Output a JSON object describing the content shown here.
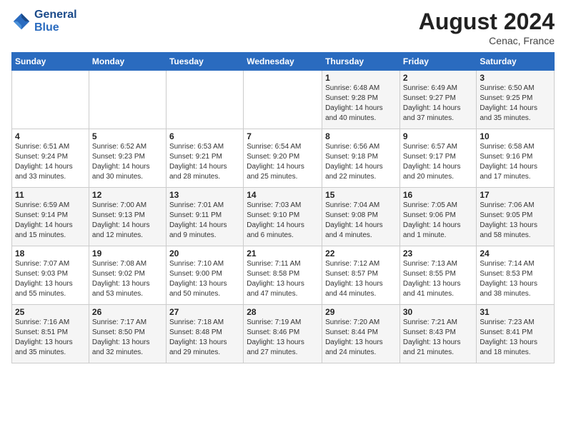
{
  "header": {
    "logo_line1": "General",
    "logo_line2": "Blue",
    "month_title": "August 2024",
    "location": "Cenac, France"
  },
  "weekdays": [
    "Sunday",
    "Monday",
    "Tuesday",
    "Wednesday",
    "Thursday",
    "Friday",
    "Saturday"
  ],
  "weeks": [
    [
      {
        "day": "",
        "info": ""
      },
      {
        "day": "",
        "info": ""
      },
      {
        "day": "",
        "info": ""
      },
      {
        "day": "",
        "info": ""
      },
      {
        "day": "1",
        "info": "Sunrise: 6:48 AM\nSunset: 9:28 PM\nDaylight: 14 hours\nand 40 minutes."
      },
      {
        "day": "2",
        "info": "Sunrise: 6:49 AM\nSunset: 9:27 PM\nDaylight: 14 hours\nand 37 minutes."
      },
      {
        "day": "3",
        "info": "Sunrise: 6:50 AM\nSunset: 9:25 PM\nDaylight: 14 hours\nand 35 minutes."
      }
    ],
    [
      {
        "day": "4",
        "info": "Sunrise: 6:51 AM\nSunset: 9:24 PM\nDaylight: 14 hours\nand 33 minutes."
      },
      {
        "day": "5",
        "info": "Sunrise: 6:52 AM\nSunset: 9:23 PM\nDaylight: 14 hours\nand 30 minutes."
      },
      {
        "day": "6",
        "info": "Sunrise: 6:53 AM\nSunset: 9:21 PM\nDaylight: 14 hours\nand 28 minutes."
      },
      {
        "day": "7",
        "info": "Sunrise: 6:54 AM\nSunset: 9:20 PM\nDaylight: 14 hours\nand 25 minutes."
      },
      {
        "day": "8",
        "info": "Sunrise: 6:56 AM\nSunset: 9:18 PM\nDaylight: 14 hours\nand 22 minutes."
      },
      {
        "day": "9",
        "info": "Sunrise: 6:57 AM\nSunset: 9:17 PM\nDaylight: 14 hours\nand 20 minutes."
      },
      {
        "day": "10",
        "info": "Sunrise: 6:58 AM\nSunset: 9:16 PM\nDaylight: 14 hours\nand 17 minutes."
      }
    ],
    [
      {
        "day": "11",
        "info": "Sunrise: 6:59 AM\nSunset: 9:14 PM\nDaylight: 14 hours\nand 15 minutes."
      },
      {
        "day": "12",
        "info": "Sunrise: 7:00 AM\nSunset: 9:13 PM\nDaylight: 14 hours\nand 12 minutes."
      },
      {
        "day": "13",
        "info": "Sunrise: 7:01 AM\nSunset: 9:11 PM\nDaylight: 14 hours\nand 9 minutes."
      },
      {
        "day": "14",
        "info": "Sunrise: 7:03 AM\nSunset: 9:10 PM\nDaylight: 14 hours\nand 6 minutes."
      },
      {
        "day": "15",
        "info": "Sunrise: 7:04 AM\nSunset: 9:08 PM\nDaylight: 14 hours\nand 4 minutes."
      },
      {
        "day": "16",
        "info": "Sunrise: 7:05 AM\nSunset: 9:06 PM\nDaylight: 14 hours\nand 1 minute."
      },
      {
        "day": "17",
        "info": "Sunrise: 7:06 AM\nSunset: 9:05 PM\nDaylight: 13 hours\nand 58 minutes."
      }
    ],
    [
      {
        "day": "18",
        "info": "Sunrise: 7:07 AM\nSunset: 9:03 PM\nDaylight: 13 hours\nand 55 minutes."
      },
      {
        "day": "19",
        "info": "Sunrise: 7:08 AM\nSunset: 9:02 PM\nDaylight: 13 hours\nand 53 minutes."
      },
      {
        "day": "20",
        "info": "Sunrise: 7:10 AM\nSunset: 9:00 PM\nDaylight: 13 hours\nand 50 minutes."
      },
      {
        "day": "21",
        "info": "Sunrise: 7:11 AM\nSunset: 8:58 PM\nDaylight: 13 hours\nand 47 minutes."
      },
      {
        "day": "22",
        "info": "Sunrise: 7:12 AM\nSunset: 8:57 PM\nDaylight: 13 hours\nand 44 minutes."
      },
      {
        "day": "23",
        "info": "Sunrise: 7:13 AM\nSunset: 8:55 PM\nDaylight: 13 hours\nand 41 minutes."
      },
      {
        "day": "24",
        "info": "Sunrise: 7:14 AM\nSunset: 8:53 PM\nDaylight: 13 hours\nand 38 minutes."
      }
    ],
    [
      {
        "day": "25",
        "info": "Sunrise: 7:16 AM\nSunset: 8:51 PM\nDaylight: 13 hours\nand 35 minutes."
      },
      {
        "day": "26",
        "info": "Sunrise: 7:17 AM\nSunset: 8:50 PM\nDaylight: 13 hours\nand 32 minutes."
      },
      {
        "day": "27",
        "info": "Sunrise: 7:18 AM\nSunset: 8:48 PM\nDaylight: 13 hours\nand 29 minutes."
      },
      {
        "day": "28",
        "info": "Sunrise: 7:19 AM\nSunset: 8:46 PM\nDaylight: 13 hours\nand 27 minutes."
      },
      {
        "day": "29",
        "info": "Sunrise: 7:20 AM\nSunset: 8:44 PM\nDaylight: 13 hours\nand 24 minutes."
      },
      {
        "day": "30",
        "info": "Sunrise: 7:21 AM\nSunset: 8:43 PM\nDaylight: 13 hours\nand 21 minutes."
      },
      {
        "day": "31",
        "info": "Sunrise: 7:23 AM\nSunset: 8:41 PM\nDaylight: 13 hours\nand 18 minutes."
      }
    ]
  ]
}
